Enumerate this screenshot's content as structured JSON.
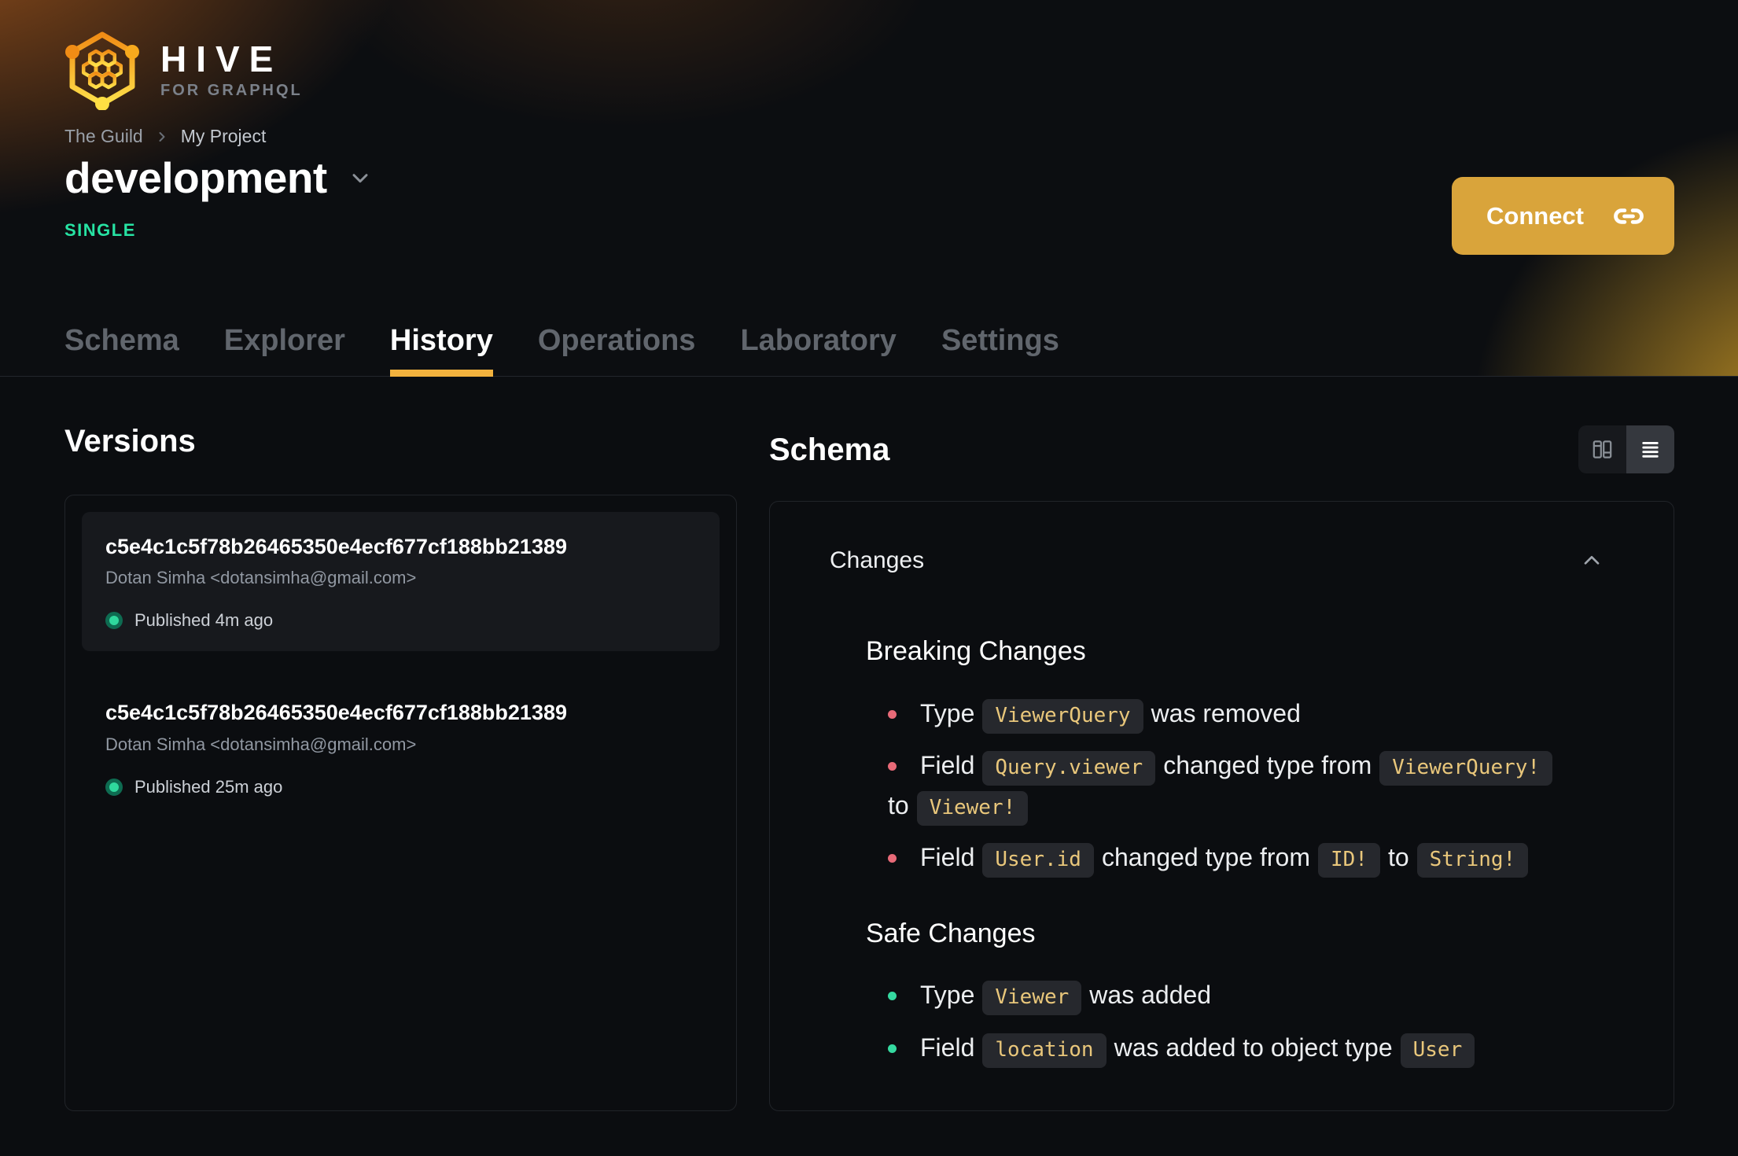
{
  "brand": {
    "name": "HIVE",
    "tagline": "FOR GRAPHQL"
  },
  "breadcrumb": {
    "org": "The Guild",
    "project": "My Project"
  },
  "target": {
    "name": "development",
    "badge": "SINGLE"
  },
  "connect": {
    "label": "Connect"
  },
  "tabs": [
    {
      "label": "Schema",
      "active": false
    },
    {
      "label": "Explorer",
      "active": false
    },
    {
      "label": "History",
      "active": true
    },
    {
      "label": "Operations",
      "active": false
    },
    {
      "label": "Laboratory",
      "active": false
    },
    {
      "label": "Settings",
      "active": false
    }
  ],
  "versions": {
    "heading": "Versions",
    "items": [
      {
        "hash": "c5e4c1c5f78b26465350e4ecf677cf188bb21389",
        "author": "Dotan Simha <dotansimha@gmail.com>",
        "status": "Published 4m ago",
        "highlighted": true
      },
      {
        "hash": "c5e4c1c5f78b26465350e4ecf677cf188bb21389",
        "author": "Dotan Simha <dotansimha@gmail.com>",
        "status": "Published 25m ago",
        "highlighted": false
      }
    ]
  },
  "schema": {
    "heading": "Schema",
    "changes": {
      "title": "Changes",
      "sections": [
        {
          "title": "Breaking Changes",
          "kind": "breaking",
          "items": [
            {
              "segments": [
                {
                  "text": "Type"
                },
                {
                  "code": "ViewerQuery"
                },
                {
                  "text": "was removed"
                }
              ]
            },
            {
              "segments": [
                {
                  "text": "Field"
                },
                {
                  "code": "Query.viewer"
                },
                {
                  "text": "changed type from"
                },
                {
                  "code": "ViewerQuery!"
                },
                {
                  "break": true
                },
                {
                  "text": "to"
                },
                {
                  "code": "Viewer!"
                }
              ]
            },
            {
              "segments": [
                {
                  "text": "Field"
                },
                {
                  "code": "User.id"
                },
                {
                  "text": "changed type from"
                },
                {
                  "code": "ID!"
                },
                {
                  "text": "to"
                },
                {
                  "code": "String!"
                }
              ]
            }
          ]
        },
        {
          "title": "Safe Changes",
          "kind": "safe",
          "items": [
            {
              "segments": [
                {
                  "text": "Type"
                },
                {
                  "code": "Viewer"
                },
                {
                  "text": "was added"
                }
              ]
            },
            {
              "segments": [
                {
                  "text": "Field"
                },
                {
                  "code": "location"
                },
                {
                  "text": "was added to object type"
                },
                {
                  "code": "User"
                }
              ]
            }
          ]
        }
      ]
    }
  },
  "colors": {
    "accent": "#f2b23e",
    "connect_button": "#d9a43b",
    "badge_single": "#27e3a3",
    "breaking_bullet": "#e86a78",
    "safe_bullet": "#35d9a0",
    "code_text": "#e9c77b",
    "published_dot": "#2fd89d"
  }
}
